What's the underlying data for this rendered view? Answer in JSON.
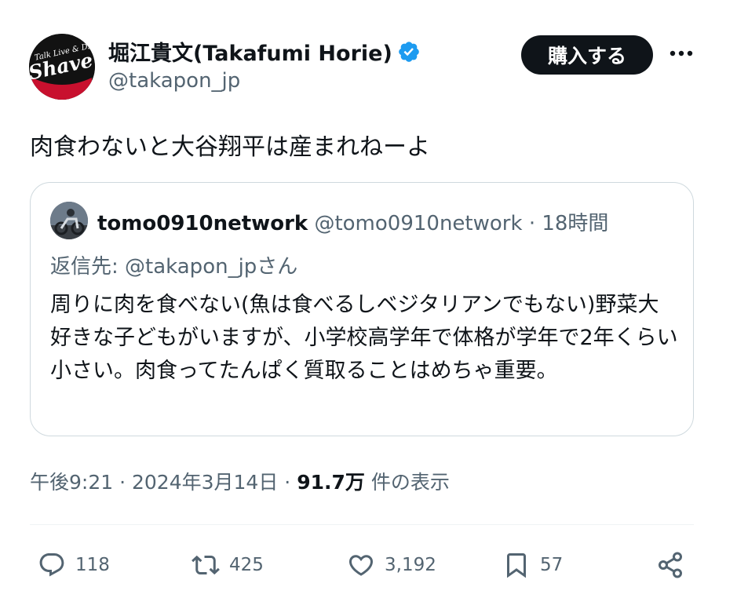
{
  "author": {
    "name": "堀江貴文(Takafumi Horie)",
    "handle": "@takapon_jp",
    "avatar_text": "Shave"
  },
  "buy_button": "購入する",
  "post_text": "肉食わないと大谷翔平は産まれねーよ",
  "quote": {
    "name": "tomo0910network",
    "handle": "@tomo0910network",
    "separator": "·",
    "time": "18時間",
    "reply_to": "返信先: @takapon_jpさん",
    "body": "周りに肉を食べない(魚は食べるしベジタリアンでもない)野菜大好きな子どもがいますが、小学校高学年で体格が学年で2年くらい小さい。肉食ってたんぱく質取ることはめちゃ重要。"
  },
  "meta": {
    "time": "午後9:21",
    "sep1": "·",
    "date": "2024年3月14日",
    "sep2": "·",
    "views": "91.7万",
    "views_label": "件の表示"
  },
  "actions": {
    "reply": "118",
    "repost": "425",
    "like": "3,192",
    "bookmark": "57"
  },
  "colors": {
    "text": "#0f1419",
    "secondary": "#536471",
    "verified": "#1d9bf0",
    "border": "#cfd9de"
  }
}
